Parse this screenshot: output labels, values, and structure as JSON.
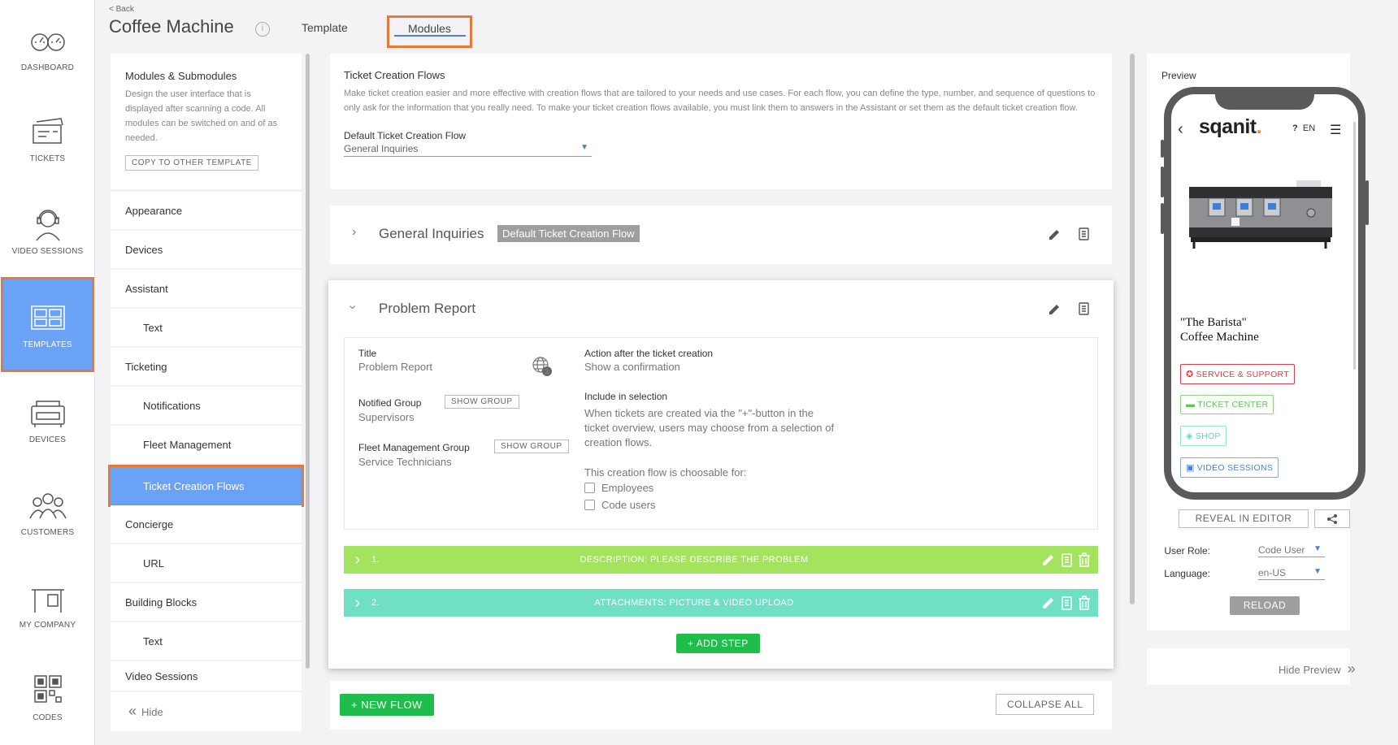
{
  "nav": {
    "items": [
      {
        "label": "DASHBOARD",
        "icon": "dashboard-icon"
      },
      {
        "label": "TICKETS",
        "icon": "tickets-icon"
      },
      {
        "label": "VIDEO SESSIONS",
        "icon": "headset-icon"
      },
      {
        "label": "TEMPLATES",
        "icon": "templates-icon"
      },
      {
        "label": "DEVICES",
        "icon": "devices-icon"
      },
      {
        "label": "CUSTOMERS",
        "icon": "customers-icon"
      },
      {
        "label": "MY COMPANY",
        "icon": "company-icon"
      },
      {
        "label": "CODES",
        "icon": "qr-code-icon"
      }
    ],
    "active": "TEMPLATES",
    "active_color": "#6aa2f5",
    "highlight_color": "#e6783a"
  },
  "header": {
    "back": "< Back",
    "title": "Coffee Machine",
    "info": "i",
    "tabs": [
      "Template",
      "Modules"
    ],
    "active_tab": "Modules"
  },
  "modules": {
    "title": "Modules & Submodules",
    "description": "Design the user interface that is displayed after scanning a code. All modules can be switched on and of as needed.",
    "copy_button": "COPY TO OTHER TEMPLATE",
    "items": [
      {
        "label": "Appearance",
        "sub": false
      },
      {
        "label": "Devices",
        "sub": false
      },
      {
        "label": "Assistant",
        "sub": false
      },
      {
        "label": "Text",
        "sub": true
      },
      {
        "label": "Ticketing",
        "sub": false
      },
      {
        "label": "Notifications",
        "sub": true
      },
      {
        "label": "Fleet Management",
        "sub": true
      },
      {
        "label": "Ticket Creation Flows",
        "sub": true
      },
      {
        "label": "Concierge",
        "sub": false
      },
      {
        "label": "URL",
        "sub": true
      },
      {
        "label": "Building Blocks",
        "sub": false
      },
      {
        "label": "Text",
        "sub": true
      },
      {
        "label": "Video Sessions",
        "sub": false
      }
    ],
    "active_item": "Ticket Creation Flows",
    "hide": "Hide"
  },
  "tcf": {
    "title": "Ticket Creation Flows",
    "description": "Make ticket creation easier and more effective with creation flows that are tailored to your needs and use cases. For each flow, you can define the type, number, and sequence of questions to only ask for the information that you really need. To make your ticket creation flows available, you must link them to answers in the Assistant or set them as the default ticket creation flow.",
    "default_label": "Default Ticket Creation Flow",
    "default_value": "General Inquiries"
  },
  "flows": {
    "general": {
      "name": "General Inquiries",
      "badge": "Default Ticket Creation Flow"
    },
    "problem": {
      "name": "Problem Report",
      "title_label": "Title",
      "title_value": "Problem Report",
      "globe_count": "2",
      "notified_label": "Notified Group",
      "notified_value": "Supervisors",
      "show_group": "SHOW GROUP",
      "fleet_label": "Fleet Management Group",
      "fleet_value": "Service Technicians",
      "action_label": "Action after the ticket creation",
      "action_value": "Show a confirmation",
      "include_label": "Include in selection",
      "include_text": "When tickets are created via the \"+\"-button in the ticket overview, users may choose from a selection of creation flows.",
      "choosable_label": "This creation flow is choosable for:",
      "options": [
        "Employees",
        "Code users"
      ],
      "steps": [
        {
          "num": "1.",
          "title": "DESCRIPTION: PLEASE DESCRIBE THE PROBLEM",
          "color": "#a3e35e"
        },
        {
          "num": "2.",
          "title": "ATTACHMENTS: PICTURE & VIDEO UPLOAD",
          "color": "#6fe0c4"
        }
      ],
      "add_step": "+ ADD STEP"
    }
  },
  "bottom": {
    "new_flow": "+ NEW FLOW",
    "collapse_all": "COLLAPSE ALL"
  },
  "preview": {
    "title": "Preview",
    "logo": "sqanit",
    "logo_dot": ".",
    "help": "?",
    "lang": "EN",
    "product_line1": "\"The Barista\"",
    "product_line2": "Coffee Machine",
    "buttons": [
      "SERVICE & SUPPORT",
      "TICKET CENTER",
      "SHOP",
      "VIDEO SESSIONS"
    ],
    "reveal": "REVEAL IN EDITOR",
    "user_role_label": "User Role:",
    "user_role_value": "Code User",
    "language_label": "Language:",
    "language_value": "en-US",
    "reload": "RELOAD",
    "hide_preview": "Hide Preview"
  }
}
